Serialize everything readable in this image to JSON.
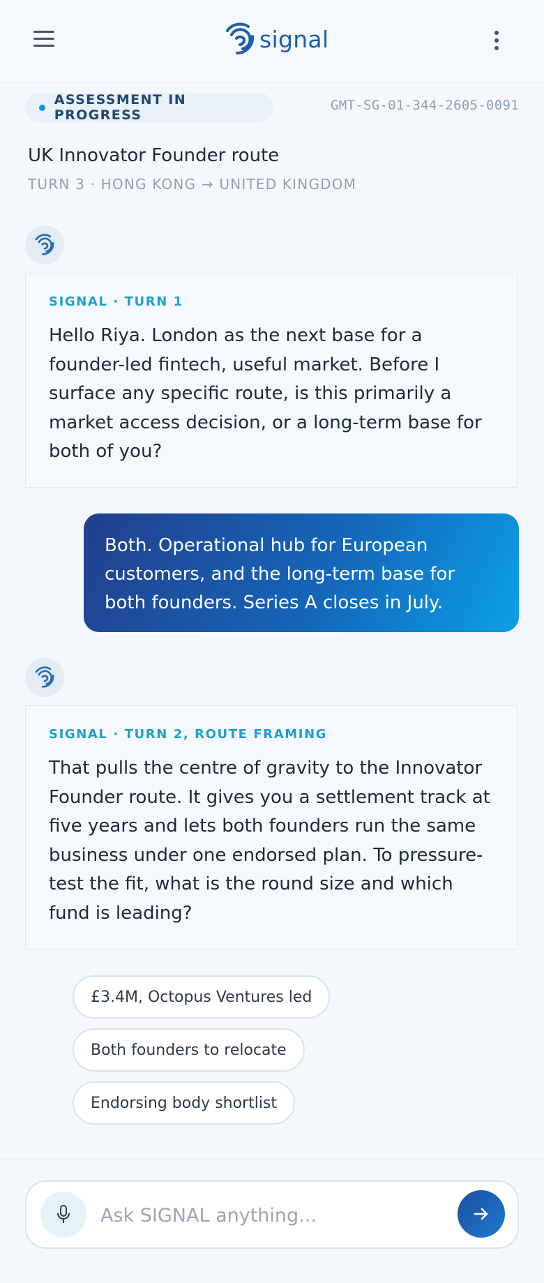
{
  "app": {
    "name": "signal",
    "brand_color": "#1b5fa8",
    "icons": {
      "menu": "hamburger-icon",
      "logo": "signal-logo-icon",
      "more": "more-vertical-icon"
    }
  },
  "status": {
    "badge": "ASSESSMENT IN PROGRESS",
    "case_id": "GMT-SG-01-344-2605-0091"
  },
  "route": {
    "title": "UK Innovator Founder route",
    "subtitle": "TURN 3 · HONG KONG → UNITED KINGDOM"
  },
  "messages": [
    {
      "sender": "signal",
      "label": "SIGNAL · TURN 1",
      "text": "Hello Riya. London as the next base for a founder-led fintech, useful market. Before I surface any specific route, is this primarily a market access decision, or a long-term base for both of you?"
    },
    {
      "sender": "user",
      "text": "Both. Operational hub for European customers, and the long-term base for both founders. Series A closes in July."
    },
    {
      "sender": "signal",
      "label": "SIGNAL · TURN 2, ROUTE FRAMING",
      "text": "That pulls the centre of gravity to the Innovator Founder route. It gives you a settlement track at five years and lets both founders run the same business under one endorsed plan. To pressure-test the fit, what is the round size and which fund is leading?"
    }
  ],
  "suggestions": [
    "£3.4M, Octopus Ventures led",
    "Both founders to relocate",
    "Endorsing body shortlist"
  ],
  "composer": {
    "placeholder": "Ask SIGNAL anything...",
    "value": "",
    "icons": {
      "mic": "microphone-icon",
      "send": "arrow-right-icon"
    }
  },
  "colors": {
    "accent": "#1fa0c9",
    "status_dot": "#1b8fd6",
    "user_bubble_start": "#223f8c",
    "user_bubble_end": "#0aa0e6"
  }
}
